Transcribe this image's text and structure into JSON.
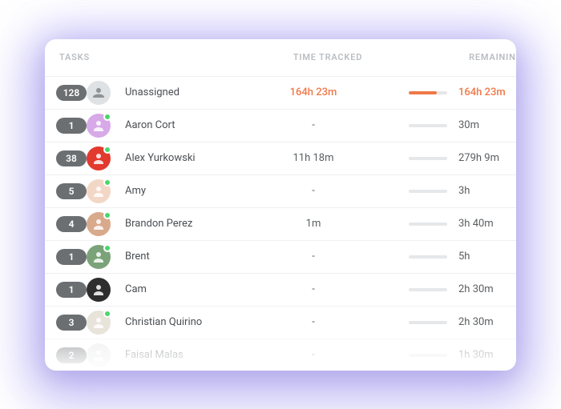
{
  "header": {
    "tasks": "TASKS",
    "time_tracked": "TIME TRACKED",
    "remaining": "REMAINING"
  },
  "colors": {
    "highlight": "#f07848",
    "bar_bg": "#e5e7e9"
  },
  "rows": [
    {
      "count": "128",
      "name": "Unassigned",
      "tracked": "164h 23m",
      "remaining": "164h 23m",
      "highlight": true,
      "online": false,
      "avatar_bg": "#dfe2e4",
      "avatar_icon": "group",
      "bar_fill_pct": 72,
      "bar_color": "#f07848"
    },
    {
      "count": "1",
      "name": "Aaron Cort",
      "tracked": "-",
      "remaining": "30m",
      "highlight": false,
      "online": true,
      "avatar_bg": "#d7a9e8",
      "avatar_icon": "person",
      "bar_fill_pct": 0,
      "bar_color": "#e5e7e9"
    },
    {
      "count": "38",
      "name": "Alex Yurkowski",
      "tracked": "11h 18m",
      "remaining": "279h 9m",
      "highlight": false,
      "online": true,
      "avatar_bg": "#e23a2e",
      "avatar_icon": "person",
      "bar_fill_pct": 0,
      "bar_color": "#e5e7e9"
    },
    {
      "count": "5",
      "name": "Amy",
      "tracked": "-",
      "remaining": "3h",
      "highlight": false,
      "online": true,
      "avatar_bg": "#f3d7c6",
      "avatar_icon": "person",
      "bar_fill_pct": 0,
      "bar_color": "#e5e7e9"
    },
    {
      "count": "4",
      "name": "Brandon Perez",
      "tracked": "1m",
      "remaining": "3h 40m",
      "highlight": false,
      "online": true,
      "avatar_bg": "#d9a98c",
      "avatar_icon": "person",
      "bar_fill_pct": 0,
      "bar_color": "#e5e7e9"
    },
    {
      "count": "1",
      "name": "Brent",
      "tracked": "-",
      "remaining": "5h",
      "highlight": false,
      "online": true,
      "avatar_bg": "#7aa37a",
      "avatar_icon": "person",
      "bar_fill_pct": 0,
      "bar_color": "#e5e7e9"
    },
    {
      "count": "1",
      "name": "Cam",
      "tracked": "-",
      "remaining": "2h 30m",
      "highlight": false,
      "online": false,
      "avatar_bg": "#2e2e2e",
      "avatar_icon": "person",
      "bar_fill_pct": 0,
      "bar_color": "#e5e7e9"
    },
    {
      "count": "3",
      "name": "Christian Quirino",
      "tracked": "-",
      "remaining": "2h 30m",
      "highlight": false,
      "online": true,
      "avatar_bg": "#e8e4da",
      "avatar_icon": "person",
      "bar_fill_pct": 0,
      "bar_color": "#e5e7e9"
    },
    {
      "count": "2",
      "name": "Faisal Malas",
      "tracked": "-",
      "remaining": "1h 30m",
      "highlight": false,
      "online": false,
      "avatar_bg": "#e6e6e6",
      "avatar_icon": "person",
      "bar_fill_pct": 0,
      "bar_color": "#e5e7e9"
    }
  ]
}
